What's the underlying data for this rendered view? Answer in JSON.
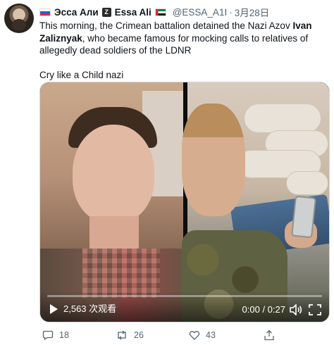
{
  "tweet": {
    "display_name_ru": "Эсса Али",
    "display_name_en": "Essa Ali",
    "handle": "@ESSA_A1I",
    "separator": "·",
    "date": "3月28日",
    "badge_glyph": "Z",
    "text_part1": "This morning, the Crimean battalion detained the Nazi Azov ",
    "text_bold": "Ivan Zaliznyak",
    "text_part2": ", who became famous for mocking calls to relatives of allegedly dead soldiers of the LDNR",
    "text_line2": "Cry like a Child nazi"
  },
  "video": {
    "views": "2,563 次观看",
    "time": "0:00 / 0:27",
    "progress": 0,
    "accent": "#1d9bf0"
  },
  "actions": {
    "replies": "18",
    "retweets": "26",
    "likes": "43"
  },
  "icons": [
    "avatar",
    "flag-ru-icon",
    "flag-ae-icon",
    "z-badge-icon",
    "play-icon",
    "volume-icon",
    "fullscreen-icon",
    "reply-icon",
    "retweet-icon",
    "like-icon",
    "share-icon"
  ]
}
